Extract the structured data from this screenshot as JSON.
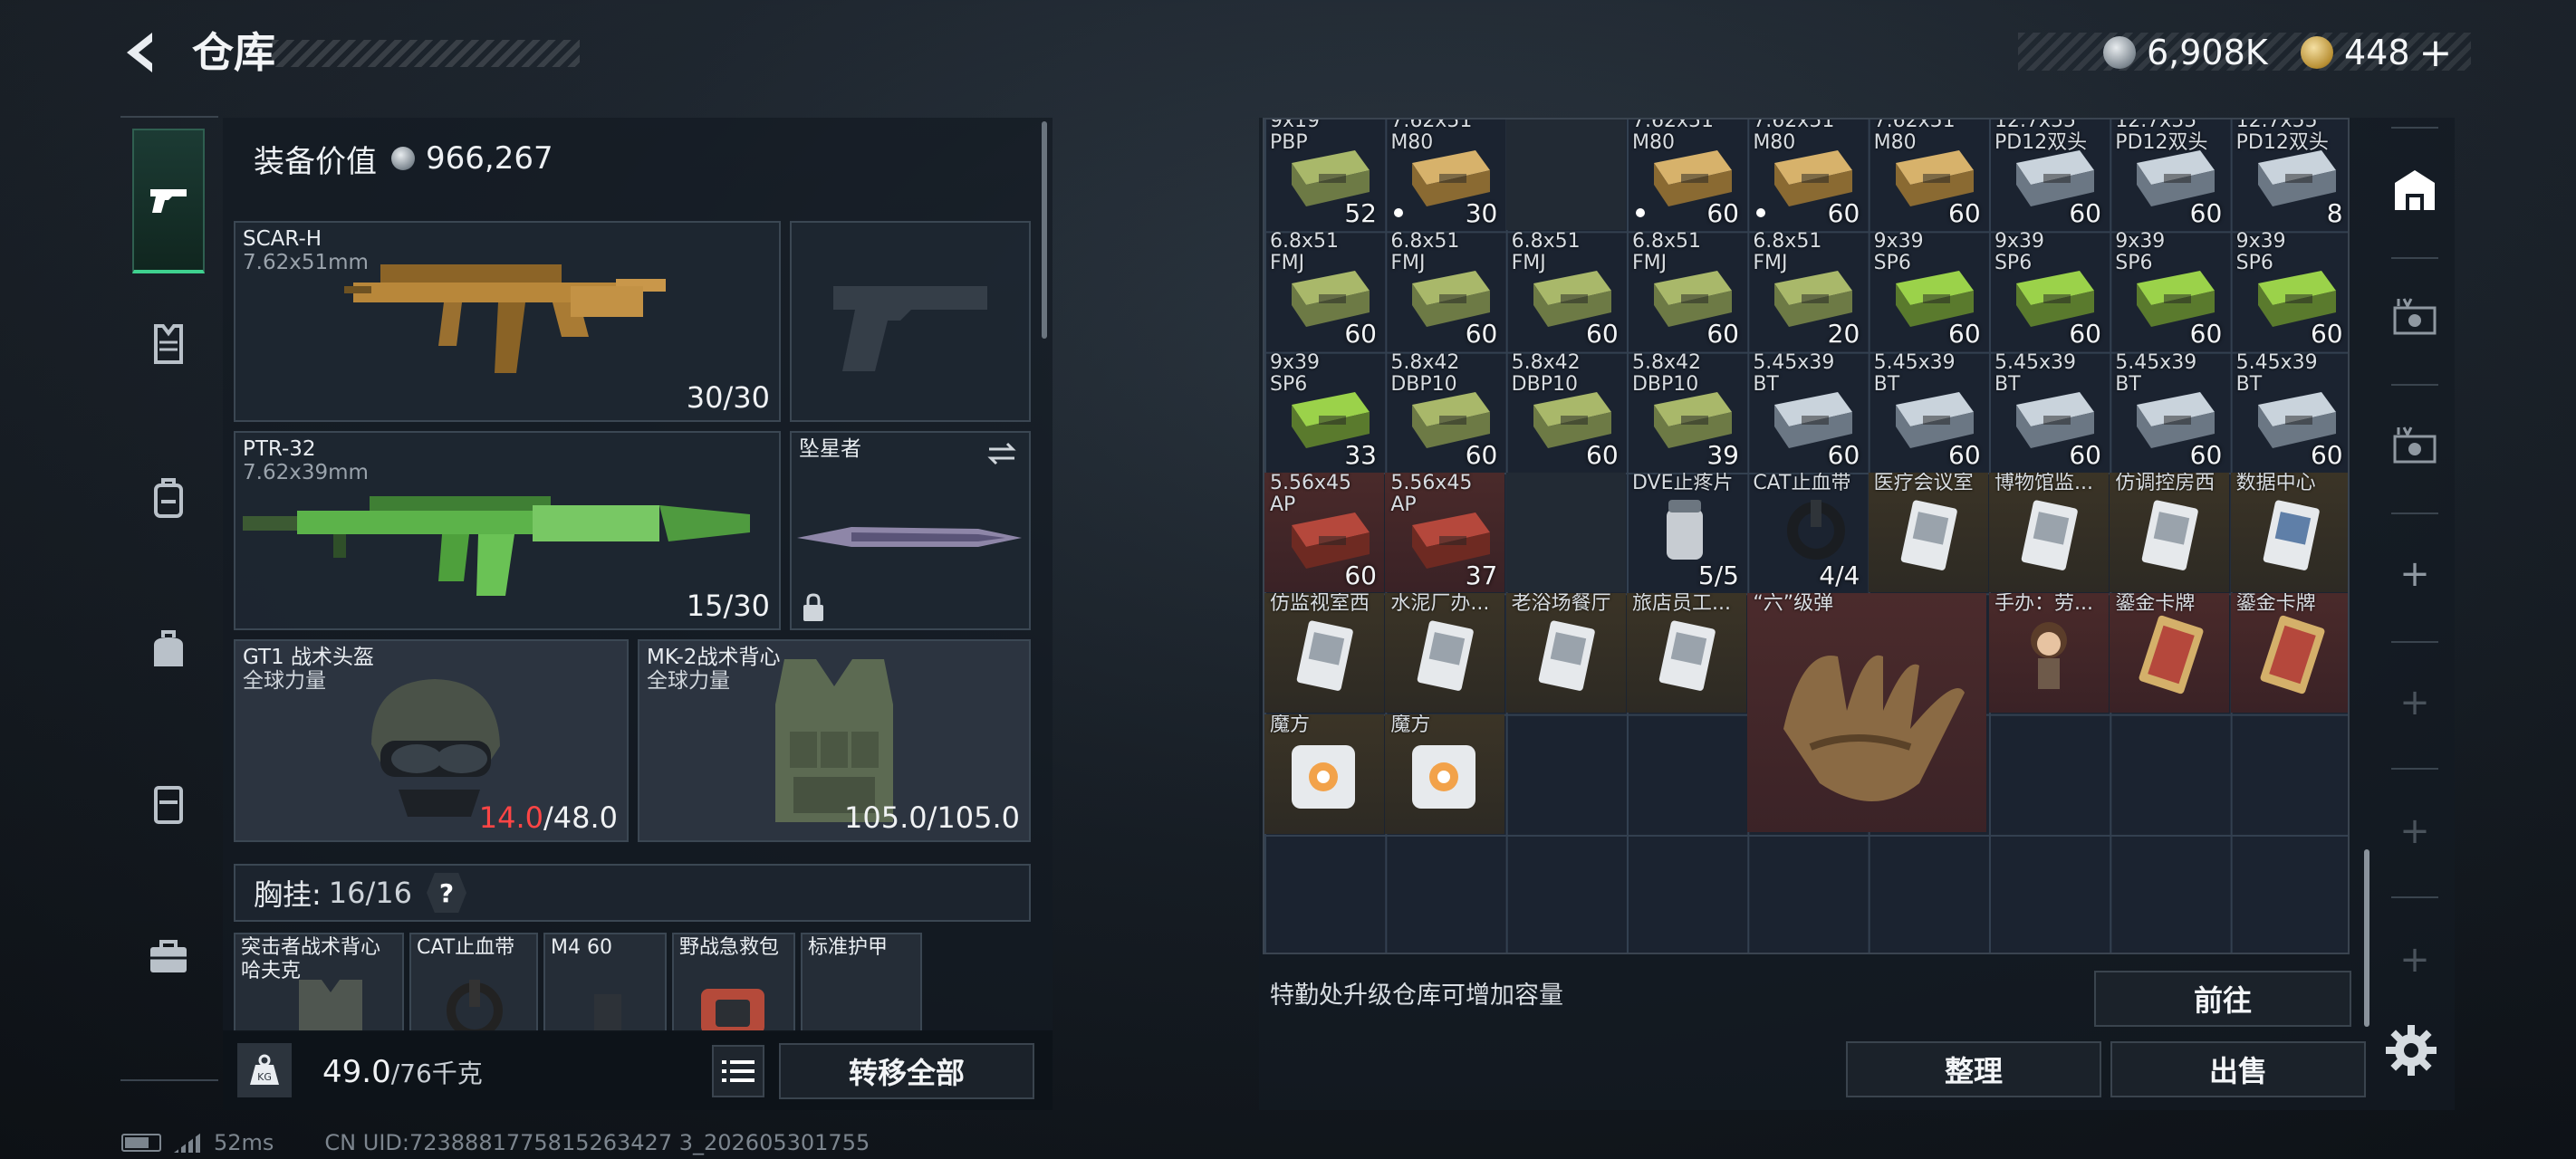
{
  "header": {
    "title": "仓库"
  },
  "currency": [
    {
      "icon": "silver-coin-icon",
      "value": "6,908K"
    },
    {
      "icon": "gold-coin-icon",
      "value": "448"
    }
  ],
  "currency_plus": "+",
  "left_panel": {
    "equip_value_label": "装备价值",
    "equip_value": "966,267",
    "primary_weapon": {
      "name": "SCAR-H",
      "caliber": "7.62x51mm",
      "ammo": "30/30"
    },
    "secondary_weapon": {
      "name": "PTR-32",
      "caliber": "7.62x39mm",
      "ammo": "15/30"
    },
    "melee": {
      "name": "坠星者"
    },
    "helmet": {
      "name": "GT1 战术头盔",
      "brand": "全球力量",
      "durability_cur": "14.0",
      "durability_max": "/48.0"
    },
    "armor": {
      "name": "MK-2战术背心",
      "brand": "全球力量",
      "durability": "105.0/105.0"
    },
    "chest_rig": {
      "label": "胸挂:",
      "capacity": "16/16",
      "help": "?"
    },
    "rig_slots": [
      "突击者战术背心 哈夫克",
      "CAT止血带",
      "M4 60",
      "野战急救包",
      "标准护甲"
    ],
    "weight": "49.0",
    "weight_max": "/76千克",
    "transfer_all": "转移全部"
  },
  "grid": {
    "rows": [
      [
        {
          "label": "9x19\nPBP",
          "count": "52",
          "type": "ammo-green"
        },
        {
          "label": "7.62x51\nM80",
          "count": "30",
          "type": "ammo-gold",
          "dot": true
        },
        {
          "label": "",
          "count": "",
          "type": "empty-dark"
        },
        {
          "label": "7.62x51\nM80",
          "count": "60",
          "type": "ammo-gold",
          "dot": true
        },
        {
          "label": "7.62x51\nM80",
          "count": "60",
          "type": "ammo-gold",
          "dot": true
        },
        {
          "label": "7.62x51\nM80",
          "count": "60",
          "type": "ammo-gold"
        },
        {
          "label": "12.7x55\nPD12双头",
          "count": "60",
          "type": "ammo-white"
        },
        {
          "label": "12.7x55\nPD12双头",
          "count": "60",
          "type": "ammo-white"
        },
        {
          "label": "12.7x55\nPD12双头",
          "count": "8",
          "type": "ammo-white"
        }
      ],
      [
        {
          "label": "6.8x51\nFMJ",
          "count": "60",
          "type": "ammo-green"
        },
        {
          "label": "6.8x51\nFMJ",
          "count": "60",
          "type": "ammo-green"
        },
        {
          "label": "6.8x51\nFMJ",
          "count": "60",
          "type": "ammo-green"
        },
        {
          "label": "6.8x51\nFMJ",
          "count": "60",
          "type": "ammo-green"
        },
        {
          "label": "6.8x51\nFMJ",
          "count": "20",
          "type": "ammo-green"
        },
        {
          "label": "9x39\nSP6",
          "count": "60",
          "type": "ammo-lime"
        },
        {
          "label": "9x39\nSP6",
          "count": "60",
          "type": "ammo-lime"
        },
        {
          "label": "9x39\nSP6",
          "count": "60",
          "type": "ammo-lime"
        },
        {
          "label": "9x39\nSP6",
          "count": "60",
          "type": "ammo-lime"
        }
      ],
      [
        {
          "label": "9x39\nSP6",
          "count": "33",
          "type": "ammo-lime"
        },
        {
          "label": "5.8x42\nDBP10",
          "count": "60",
          "type": "ammo-green"
        },
        {
          "label": "5.8x42\nDBP10",
          "count": "60",
          "type": "ammo-green"
        },
        {
          "label": "5.8x42\nDBP10",
          "count": "39",
          "type": "ammo-green"
        },
        {
          "label": "5.45x39\nBT",
          "count": "60",
          "type": "ammo-white"
        },
        {
          "label": "5.45x39\nBT",
          "count": "60",
          "type": "ammo-white"
        },
        {
          "label": "5.45x39\nBT",
          "count": "60",
          "type": "ammo-white"
        },
        {
          "label": "5.45x39\nBT",
          "count": "60",
          "type": "ammo-white"
        },
        {
          "label": "5.45x39\nBT",
          "count": "60",
          "type": "ammo-white"
        }
      ],
      [
        {
          "label": "5.56x45\nAP",
          "count": "60",
          "type": "ammo-red"
        },
        {
          "label": "5.56x45\nAP",
          "count": "37",
          "type": "ammo-red"
        },
        {
          "label": "",
          "count": "",
          "type": "empty-dark"
        },
        {
          "label": "DVE止疼片",
          "count": "5/5",
          "type": "pill"
        },
        {
          "label": "CAT止血带",
          "count": "4/4",
          "type": "tourniquet"
        },
        {
          "label": "医疗会议室",
          "count": "",
          "type": "keycard-gold"
        },
        {
          "label": "博物馆监...",
          "count": "",
          "type": "keycard-gold"
        },
        {
          "label": "仿调控房西",
          "count": "",
          "type": "keycard-gold"
        },
        {
          "label": "数据中心",
          "count": "",
          "type": "keycard-blue"
        }
      ],
      [
        {
          "label": "仿监视室西",
          "count": "",
          "type": "keycard-gold"
        },
        {
          "label": "水泥厂办...",
          "count": "",
          "type": "keycard"
        },
        {
          "label": "老浴场餐厅",
          "count": "",
          "type": "keycard"
        },
        {
          "label": "旅店员工...",
          "count": "",
          "type": "keycard"
        },
        {
          "label": "“六”级弹",
          "count": "",
          "type": "big-relic"
        },
        {
          "label": "手办：劳...",
          "count": "",
          "type": "figure-red"
        },
        {
          "label": "鎏金卡牌",
          "count": "",
          "type": "card-red"
        },
        {
          "label": "鎏金卡牌",
          "count": "",
          "type": "card-red"
        }
      ],
      [
        {
          "label": "魔方",
          "count": "",
          "type": "cube"
        },
        {
          "label": "魔方",
          "count": "",
          "type": "cube"
        }
      ]
    ]
  },
  "hint": "特勤处升级仓库可增加容量",
  "buttons": {
    "goto": "前往",
    "sort": "整理",
    "sell": "出售"
  },
  "status": {
    "ping": "52ms",
    "uid": "CN UID:7238881775815263427 3_202605301755"
  }
}
